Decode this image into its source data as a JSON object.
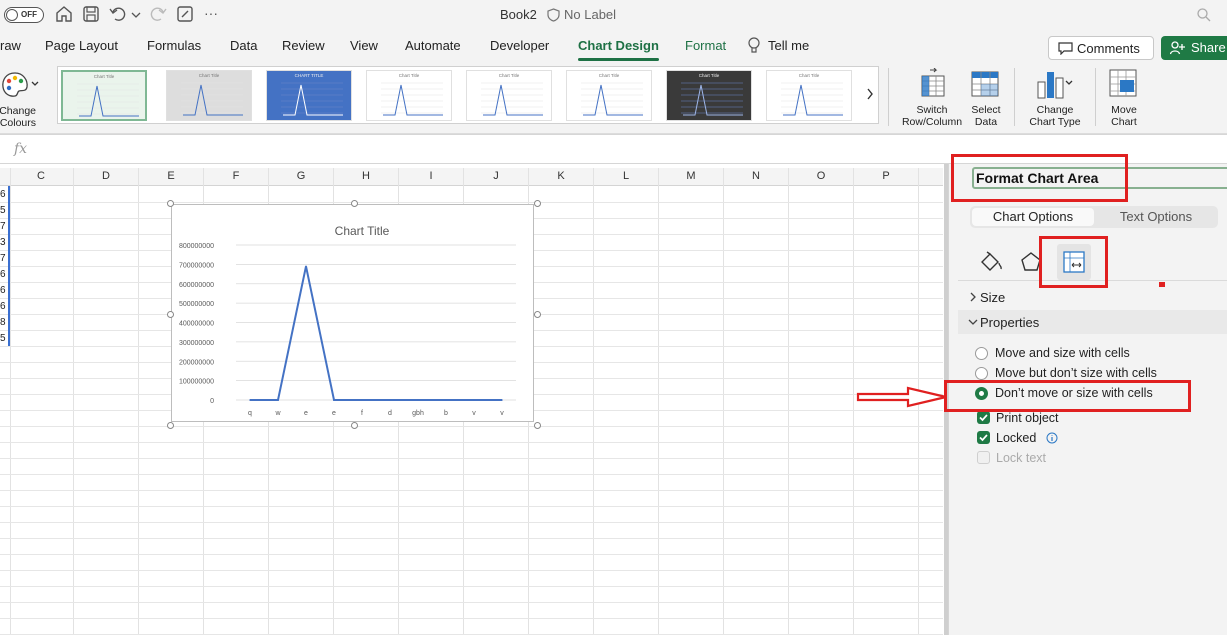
{
  "titlebar": {
    "autosave_label": "OFF",
    "doc_title": "Book2",
    "sensitivity_label": "No Label",
    "more": "···"
  },
  "tabs": [
    {
      "label": "raw",
      "state": "normal"
    },
    {
      "label": "Page Layout",
      "state": "normal"
    },
    {
      "label": "Formulas",
      "state": "normal"
    },
    {
      "label": "Data",
      "state": "normal"
    },
    {
      "label": "Review",
      "state": "normal"
    },
    {
      "label": "View",
      "state": "normal"
    },
    {
      "label": "Automate",
      "state": "normal"
    },
    {
      "label": "Developer",
      "state": "normal"
    },
    {
      "label": "Chart Design",
      "state": "active"
    },
    {
      "label": "Format",
      "state": "contextual"
    },
    {
      "label": "Tell me",
      "state": "normal"
    }
  ],
  "header_buttons": {
    "comments": "Comments",
    "share": "Share"
  },
  "ribbon": {
    "change_colours": "Change\nColours",
    "switch_row_column": "Switch\nRow/Column",
    "select_data": "Select\nData",
    "change_chart_type": "Change\nChart Type",
    "move_chart": "Move\nChart"
  },
  "chart_styles": {
    "count": 8,
    "selected_index": 0,
    "titles": [
      "Chart Title",
      "Chart Title",
      "CHART TITLE",
      "Chart Title",
      "Chart Title",
      "Chart Title",
      "Chart Title",
      "Chart Title"
    ]
  },
  "formula_bar": {
    "fx": "fx",
    "value": ""
  },
  "sheet": {
    "columns": [
      "C",
      "D",
      "E",
      "F",
      "G",
      "H",
      "I",
      "J",
      "K",
      "L",
      "M",
      "N",
      "O",
      "P"
    ],
    "col_a_values": [
      "6",
      "5",
      "7",
      "3",
      "7",
      "6",
      "6",
      "6",
      "8",
      "5"
    ]
  },
  "chart_data": {
    "type": "line",
    "title": "Chart Title",
    "categories": [
      "q",
      "w",
      "e",
      "e",
      "f",
      "d",
      "gbh",
      "b",
      "v",
      "v"
    ],
    "series": [
      {
        "values": [
          0,
          0,
          690000000,
          0,
          0,
          0,
          0,
          0,
          0,
          0
        ]
      }
    ],
    "ylim": [
      0,
      800000000
    ],
    "yticks": [
      "800000000",
      "700000000",
      "600000000",
      "500000000",
      "400000000",
      "300000000",
      "200000000",
      "100000000",
      "0"
    ],
    "grid": true,
    "line_color": "#4472c4"
  },
  "pane": {
    "title": "Format Chart Area",
    "tab_chart_options": "Chart Options",
    "tab_text_options": "Text Options",
    "section_size": "Size",
    "section_properties": "Properties",
    "radio_options": [
      {
        "label": "Move and size with cells",
        "checked": false
      },
      {
        "label": "Move but don’t size with cells",
        "checked": false
      },
      {
        "label": "Don’t move or size with cells",
        "checked": true
      }
    ],
    "checkboxes": [
      {
        "label": "Print object",
        "checked": true,
        "enabled": true
      },
      {
        "label": "Locked",
        "checked": true,
        "enabled": true
      },
      {
        "label": "Lock text",
        "checked": false,
        "enabled": false
      }
    ]
  },
  "colors": {
    "accent_green": "#1f7a45",
    "annotation_red": "#e02020"
  }
}
